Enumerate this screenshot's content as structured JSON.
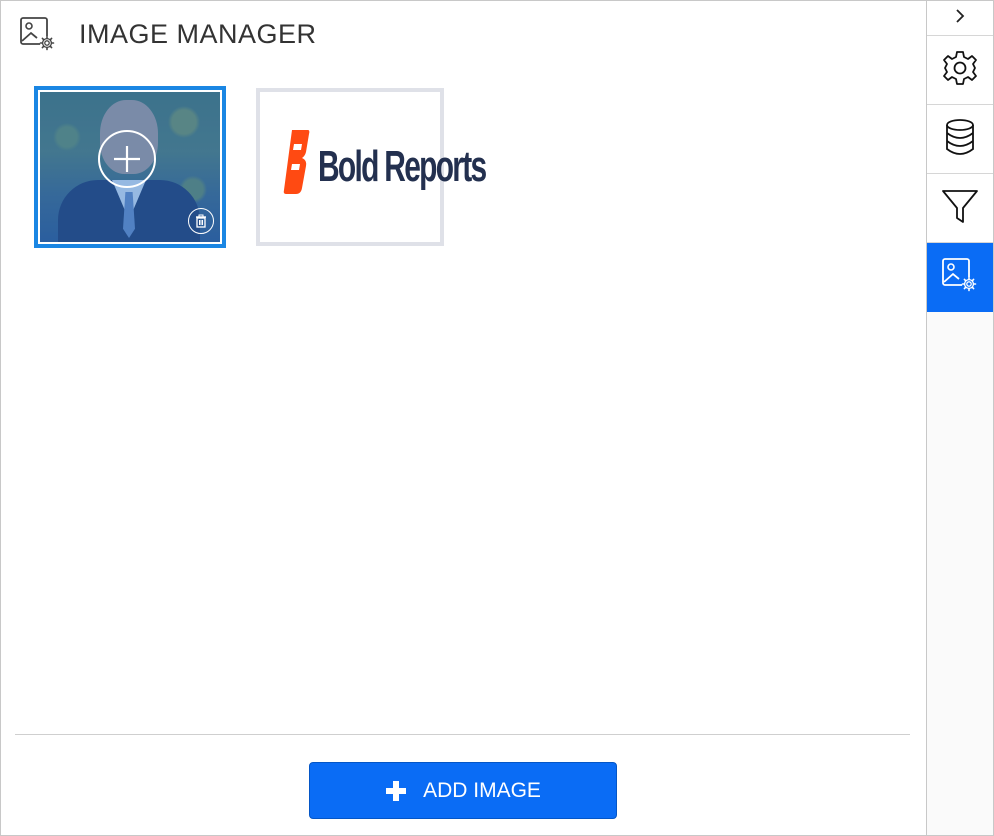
{
  "panel": {
    "title": "IMAGE MANAGER",
    "header_icon": "image-settings-icon"
  },
  "thumbnails": [
    {
      "kind": "photo",
      "selected": true,
      "overlay_icon": "plus-circle-icon",
      "delete_icon": "trash-icon"
    },
    {
      "kind": "logo",
      "selected": false,
      "logo_text": "Bold Reports"
    }
  ],
  "footer": {
    "add_button_label": "ADD IMAGE",
    "add_button_icon": "plus-icon"
  },
  "toolbar": {
    "collapse_icon": "chevron-right-icon",
    "items": [
      {
        "icon": "gear-icon",
        "active": false
      },
      {
        "icon": "database-icon",
        "active": false
      },
      {
        "icon": "filter-icon",
        "active": false
      },
      {
        "icon": "image-settings-icon",
        "active": true
      }
    ]
  },
  "colors": {
    "accent": "#0a6cf5",
    "selection_border": "#1a86e3",
    "title_text": "#333333",
    "logo_text": "#23304f",
    "logo_mark": "#ff4a12"
  }
}
